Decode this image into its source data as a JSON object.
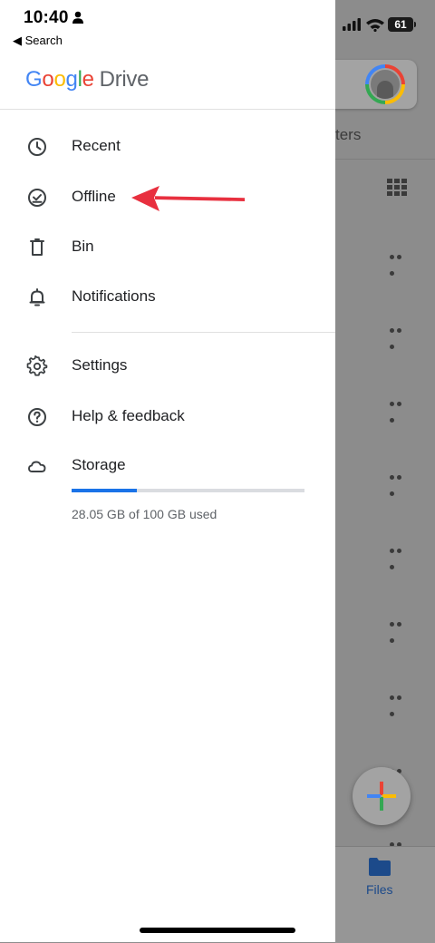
{
  "status_bar": {
    "time": "10:40",
    "back_label": "◀ Search",
    "battery": "61"
  },
  "drawer": {
    "logo": {
      "google": [
        "G",
        "o",
        "o",
        "g",
        "l",
        "e"
      ],
      "product": "Drive"
    },
    "nav_items": [
      {
        "label": "Recent",
        "icon": "clock-icon"
      },
      {
        "label": "Offline",
        "icon": "offline-check-icon"
      },
      {
        "label": "Bin",
        "icon": "trash-icon"
      },
      {
        "label": "Notifications",
        "icon": "bell-icon"
      }
    ],
    "secondary_items": [
      {
        "label": "Settings",
        "icon": "gear-icon"
      },
      {
        "label": "Help & feedback",
        "icon": "help-icon"
      },
      {
        "label": "Storage",
        "icon": "cloud-icon"
      }
    ],
    "storage": {
      "used_text": "28.05 GB of 100 GB used",
      "used_fraction": 0.2805
    }
  },
  "background": {
    "tab_fragment": "ters",
    "bottom_nav": {
      "files_label": "Files"
    }
  },
  "annotation": {
    "color": "#e8303f",
    "points_to": "Offline"
  },
  "colors": {
    "google_blue": "#4285f4",
    "google_red": "#ea4335",
    "google_yellow": "#fbbc05",
    "google_green": "#34a853",
    "storage_bar": "#1a73e8"
  }
}
